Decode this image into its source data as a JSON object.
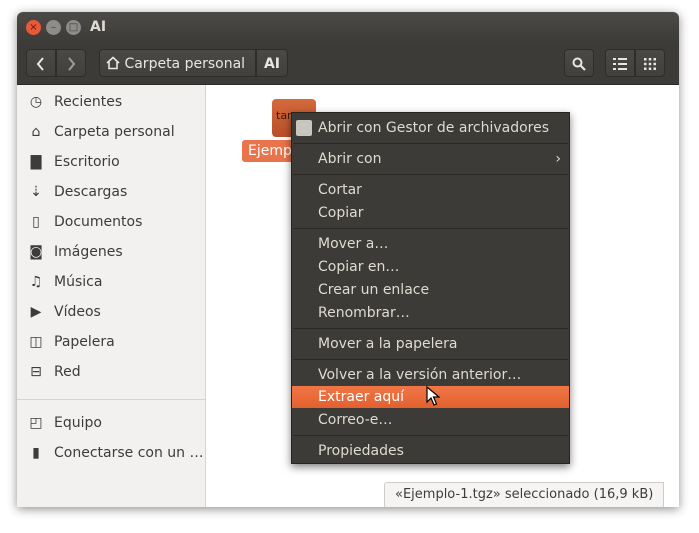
{
  "window": {
    "title": "AI",
    "close_glyph": "×",
    "min_glyph": "–",
    "max_glyph": "□"
  },
  "toolbar": {
    "back_icon": "chevron-left-icon",
    "forward_icon": "chevron-right-icon",
    "home_icon": "home-icon",
    "breadcrumb_home": "Carpeta personal",
    "breadcrumb_current": "AI",
    "search_icon": "search-icon",
    "list_view_icon": "list-view-icon",
    "grid_view_icon": "grid-view-icon"
  },
  "sidebar": {
    "items": [
      {
        "label": "Recientes",
        "icon": "clock-icon"
      },
      {
        "label": "Carpeta personal",
        "icon": "home-icon"
      },
      {
        "label": "Escritorio",
        "icon": "folder-icon"
      },
      {
        "label": "Descargas",
        "icon": "download-icon"
      },
      {
        "label": "Documentos",
        "icon": "document-icon"
      },
      {
        "label": "Imágenes",
        "icon": "camera-icon"
      },
      {
        "label": "Música",
        "icon": "music-icon"
      },
      {
        "label": "Vídeos",
        "icon": "video-icon"
      },
      {
        "label": "Papelera",
        "icon": "trash-icon"
      },
      {
        "label": "Red",
        "icon": "network-icon"
      },
      {
        "label": "Equipo",
        "icon": "computer-icon"
      },
      {
        "label": "Conectarse con un …",
        "icon": "server-icon"
      }
    ]
  },
  "content": {
    "file": {
      "label": "Ejemplo",
      "icon_tag": "tar"
    }
  },
  "status": {
    "text": "«Ejemplo-1.tgz» seleccionado  (16,9 kB)"
  },
  "context_menu": {
    "items": [
      {
        "label": "Abrir con Gestor de archivadores"
      },
      {
        "label": "Abrir con"
      },
      {
        "label": "Cortar"
      },
      {
        "label": "Copiar"
      },
      {
        "label": "Mover a…"
      },
      {
        "label": "Copiar en…"
      },
      {
        "label": "Crear un enlace"
      },
      {
        "label": "Renombrar…"
      },
      {
        "label": "Mover a la papelera"
      },
      {
        "label": "Volver a la versión anterior…"
      },
      {
        "label": "Extraer aquí"
      },
      {
        "label": "Correo-e…"
      },
      {
        "label": "Propiedades"
      }
    ],
    "submenu_arrow": "›",
    "highlight_color": "#e9673a"
  }
}
